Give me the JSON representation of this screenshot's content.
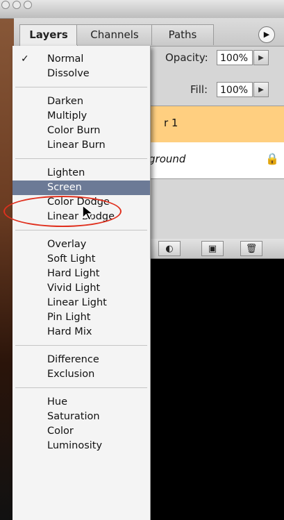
{
  "tabs": [
    "Layers",
    "Channels",
    "Paths"
  ],
  "panel_menu_icon": "triangle-right-icon",
  "opacity": {
    "label": "Opacity:",
    "value": "100%"
  },
  "fill": {
    "label": "Fill:",
    "value": "100%"
  },
  "layers": [
    {
      "name": "r 1",
      "selected": true,
      "color": "#ffcf80"
    },
    {
      "name": "ground",
      "locked": true
    }
  ],
  "blend_menu": {
    "selected": "Normal",
    "highlighted": "Screen",
    "groups": [
      [
        "Normal",
        "Dissolve"
      ],
      [
        "Darken",
        "Multiply",
        "Color Burn",
        "Linear Burn"
      ],
      [
        "Lighten",
        "Screen",
        "Color Dodge",
        "Linear Dodge"
      ],
      [
        "Overlay",
        "Soft Light",
        "Hard Light",
        "Vivid Light",
        "Linear Light",
        "Pin Light",
        "Hard Mix"
      ],
      [
        "Difference",
        "Exclusion"
      ],
      [
        "Hue",
        "Saturation",
        "Color",
        "Luminosity"
      ]
    ]
  },
  "colors": {
    "highlight": "#6c7a96",
    "selected_layer": "#ffcf80",
    "annotation": "#e0301e"
  }
}
